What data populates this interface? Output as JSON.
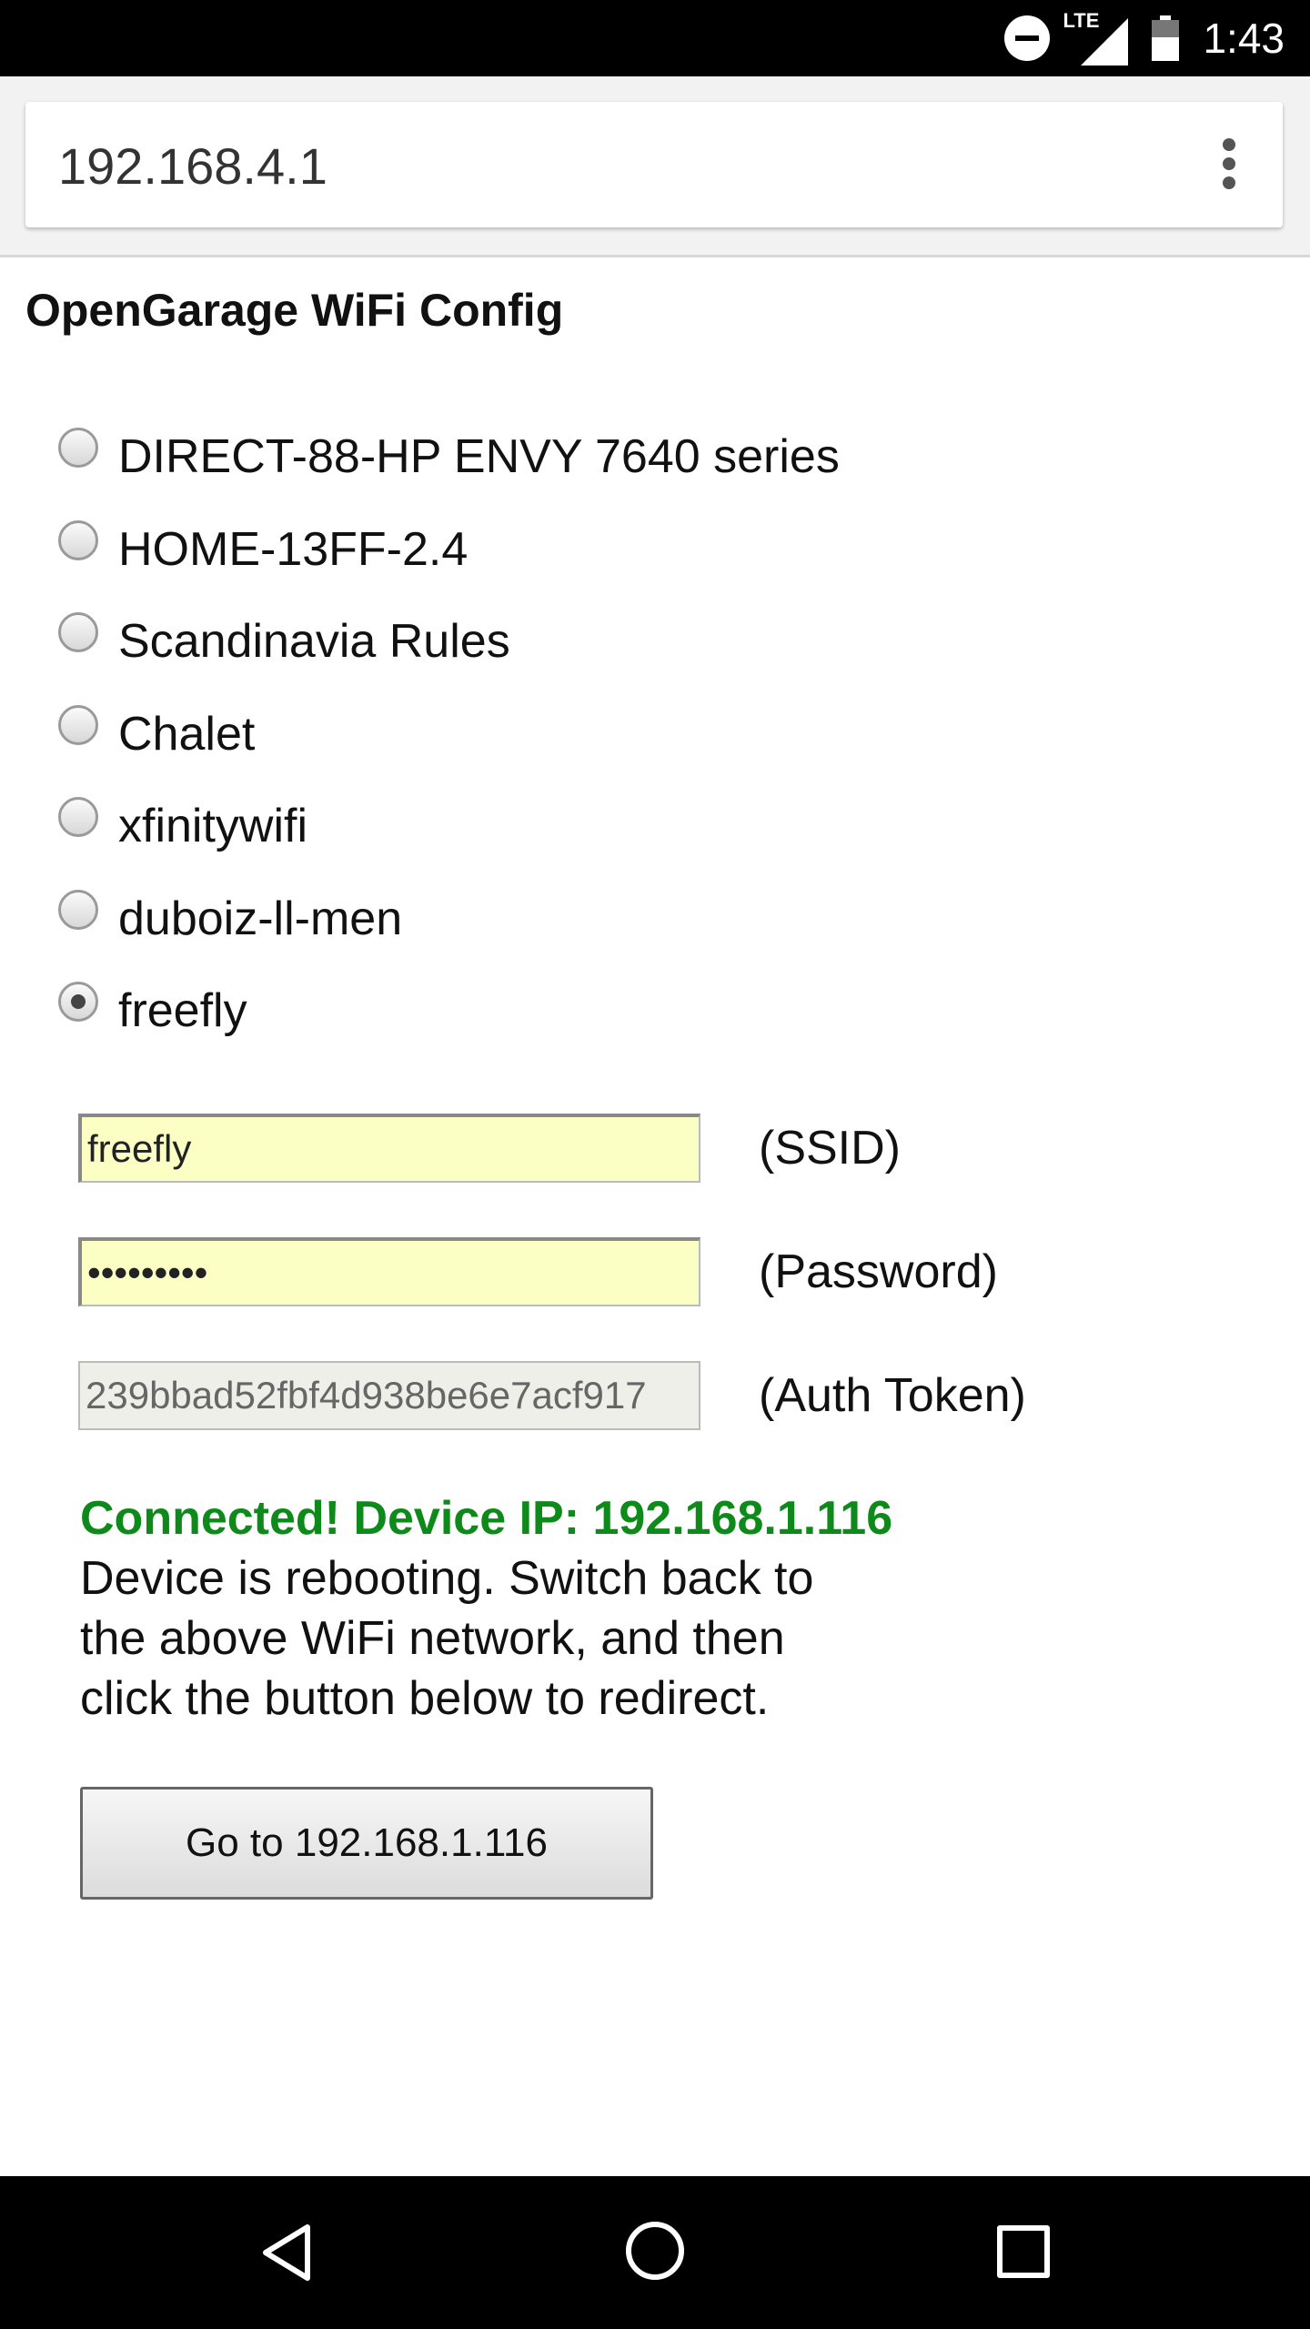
{
  "status_bar": {
    "network_label": "LTE",
    "time": "1:43",
    "icons": [
      "do-not-disturb-icon",
      "signal-icon",
      "battery-icon"
    ]
  },
  "browser": {
    "url": "192.168.4.1",
    "menu_icon": "overflow-menu-icon"
  },
  "page": {
    "title": "OpenGarage WiFi Config",
    "networks": [
      {
        "label": "DIRECT-88-HP ENVY 7640 series",
        "selected": false
      },
      {
        "label": "HOME-13FF-2.4",
        "selected": false
      },
      {
        "label": "Scandinavia Rules",
        "selected": false
      },
      {
        "label": "Chalet",
        "selected": false
      },
      {
        "label": "xfinitywifi",
        "selected": false
      },
      {
        "label": "duboiz-ll-men",
        "selected": false
      },
      {
        "label": "freefly",
        "selected": true
      }
    ],
    "fields": {
      "ssid": {
        "value": "freefly",
        "label": "(SSID)"
      },
      "password": {
        "value": "•••••••••",
        "label": "(Password)"
      },
      "auth_token": {
        "value": "239bbad52fbf4d938be6e7acf917",
        "label": "(Auth Token)"
      }
    },
    "message": {
      "connected": "Connected! Device IP: 192.168.1.116",
      "line1": "Device is rebooting. Switch back to",
      "line2": "the above WiFi network, and then",
      "line3": "click the button below to redirect."
    },
    "redirect_button": "Go to 192.168.1.116"
  },
  "nav_bar": {
    "icons": [
      "back-icon",
      "home-icon",
      "recents-icon"
    ]
  },
  "colors": {
    "success": "#0d8a1a",
    "input_autofill": "#fbffc4"
  }
}
